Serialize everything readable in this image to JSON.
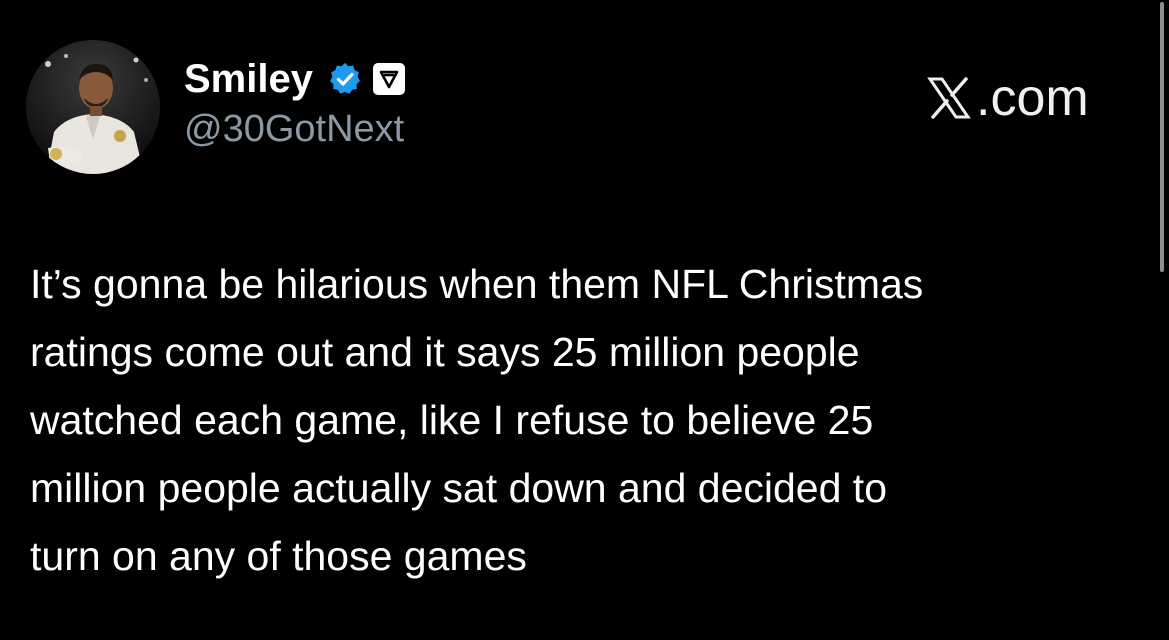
{
  "author": {
    "display_name": "Smiley",
    "handle": "@30GotNext",
    "verified_icon": "verified-badge-icon",
    "affiliate_icon": "affiliate-badge-icon",
    "verified_color": "#1d9bf0"
  },
  "brand": {
    "label": ".com",
    "icon": "x-logo-icon"
  },
  "tweet": {
    "text": "It’s gonna be hilarious when them NFL Christmas\nratings come out and it says 25 million people\nwatched each game, like I refuse to believe 25\nmillion people actually sat down and decided to\nturn on any of those games"
  },
  "theme": {
    "background": "#000000",
    "text": "#ffffff",
    "secondary_text": "#8b98a5"
  }
}
